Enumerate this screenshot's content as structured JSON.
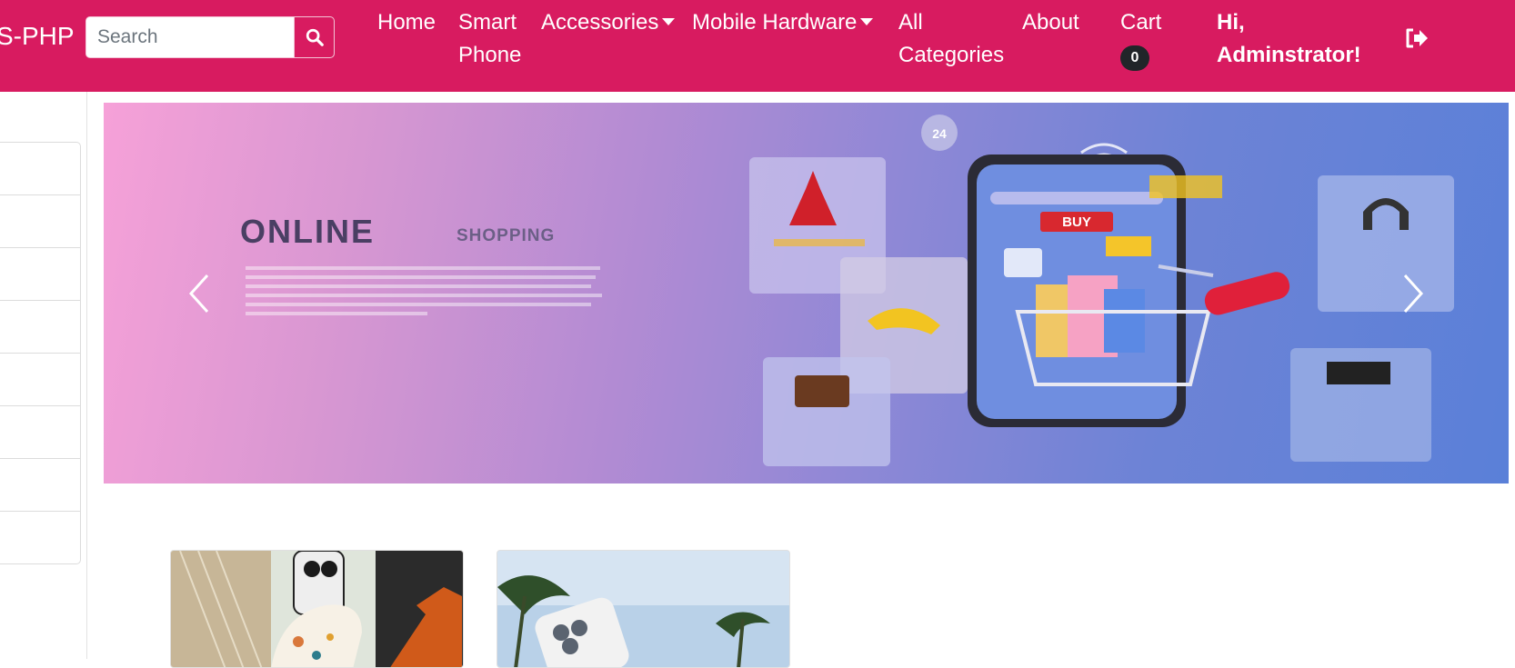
{
  "brand": {
    "text": "S-PHP"
  },
  "search": {
    "placeholder": "Search"
  },
  "nav": {
    "home": "Home",
    "smart_phone_line1": "Smart",
    "smart_phone_line2": "Phone",
    "accessories": "Accessories",
    "mobile_hardware": "Mobile Hardware",
    "all_categories_line1": "All",
    "all_categories_line2": "Categories",
    "about": "About",
    "cart": "Cart",
    "cart_count": "0"
  },
  "user": {
    "greeting_line1": "Hi,",
    "greeting_line2": "Adminstrator!"
  },
  "hero": {
    "title": "ONLINE",
    "subtitle": "SHOPPING",
    "buy_label": "BUY",
    "timer_label": "24"
  },
  "colors": {
    "navbar": "#d81b60",
    "badge": "#212529"
  },
  "icons": {
    "search": "search-icon",
    "logout": "sign-out-icon",
    "prev": "chevron-left-icon",
    "next": "chevron-right-icon"
  },
  "sidebar": {
    "item_count": 8
  },
  "products": [
    {
      "image": "phone-case-product"
    },
    {
      "image": "white-iphone-product"
    }
  ]
}
